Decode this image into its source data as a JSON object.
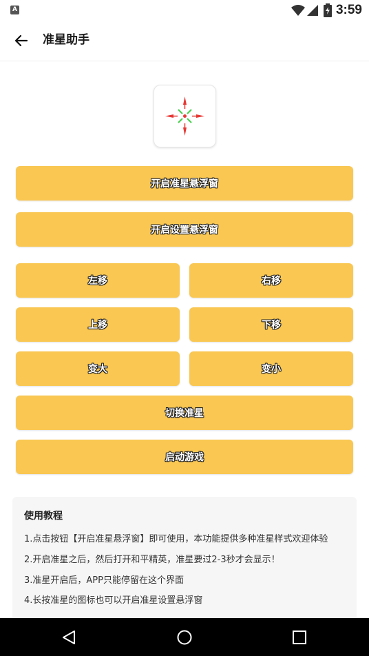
{
  "status_bar": {
    "app_icon_glyph": "A",
    "time": "3:59"
  },
  "app_bar": {
    "title": "准星助手"
  },
  "buttons": {
    "open_crosshair_window": "开启准星悬浮窗",
    "open_settings_window": "开启设置悬浮窗",
    "move_left": "左移",
    "move_right": "右移",
    "move_up": "上移",
    "move_down": "下移",
    "enlarge": "变大",
    "shrink": "变小",
    "switch_crosshair": "切换准星",
    "launch_game": "启动游戏"
  },
  "tutorial": {
    "title": "使用教程",
    "lines": [
      "1.点击按钮【开启准星悬浮窗】即可使用，本功能提供多种准星样式欢迎体验",
      "2.开启准星之后，然后打开和平精英，准星要过2-3秒才会显示！",
      "3.准星开启后，APP只能停留在这个界面",
      "4.长按准星的图标也可以开启准星设置悬浮窗"
    ]
  },
  "colors": {
    "button_bg": "#f9c752",
    "crosshair_red": "#e53935",
    "crosshair_green": "#43d04a",
    "nav_bar": "#000000"
  },
  "icons": {
    "back": "arrow-left-icon",
    "crosshair": "crosshair-icon",
    "wifi": "wifi-icon",
    "signal": "signal-icon",
    "battery": "battery-icon",
    "nav_back": "nav-back-icon",
    "nav_home": "nav-home-icon",
    "nav_recents": "nav-recents-icon"
  }
}
